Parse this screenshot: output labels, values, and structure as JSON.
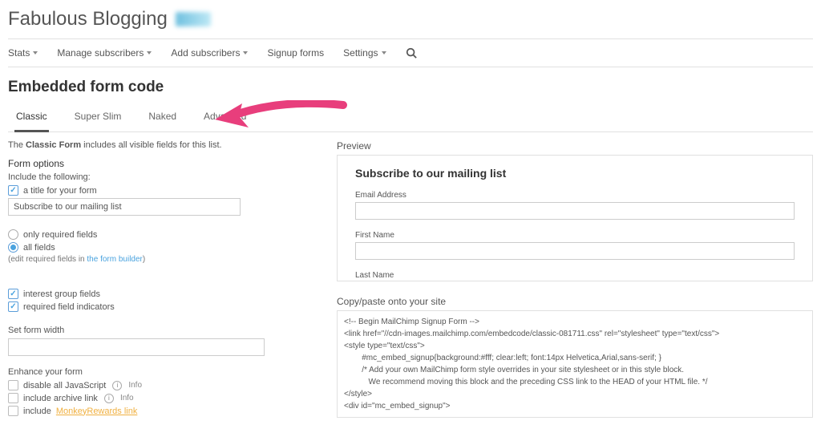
{
  "header": {
    "site_name": "Fabulous Blogging"
  },
  "nav": {
    "items": [
      "Stats",
      "Manage subscribers",
      "Add subscribers",
      "Signup forms",
      "Settings"
    ]
  },
  "page_title": "Embedded form code",
  "tabs": [
    "Classic",
    "Super Slim",
    "Naked",
    "Advanced"
  ],
  "intro": {
    "prefix": "The ",
    "bold": "Classic Form",
    "suffix": " includes all visible fields for this list."
  },
  "form_options": {
    "heading": "Form options",
    "include_label": "Include the following:",
    "title_checkbox": "a title for your form",
    "title_value": "Subscribe to our mailing list",
    "only_required": "only required fields",
    "all_fields": "all fields",
    "edit_note_prefix": "(edit required fields in ",
    "edit_note_link": "the form builder",
    "edit_note_suffix": ")",
    "interest_group": "interest group fields",
    "required_indicators": "required field indicators",
    "width_label": "Set form width",
    "enhance_label": "Enhance your form",
    "disable_js": "disable all JavaScript",
    "archive_link": "include archive link",
    "monkey_prefix": "include ",
    "monkey_link": "MonkeyRewards link",
    "info_text": "Info"
  },
  "preview": {
    "heading": "Preview",
    "title": "Subscribe to our mailing list",
    "email_label": "Email Address",
    "firstname_label": "First Name",
    "lastname_label": "Last Name"
  },
  "code": {
    "heading": "Copy/paste onto your site",
    "line1": "<!-- Begin MailChimp Signup Form -->",
    "line2": "<link href=\"//cdn-images.mailchimp.com/embedcode/classic-081711.css\" rel=\"stylesheet\" type=\"text/css\">",
    "line3": "<style type=\"text/css\">",
    "line4": "        #mc_embed_signup{background:#fff; clear:left; font:14px Helvetica,Arial,sans-serif; }",
    "line5": "        /* Add your own MailChimp form style overrides in your site stylesheet or in this style block.",
    "line6": "           We recommend moving this block and the preceding CSS link to the HEAD of your HTML file. */",
    "line7": "</style>",
    "line8": "<div id=\"mc_embed_signup\">"
  }
}
